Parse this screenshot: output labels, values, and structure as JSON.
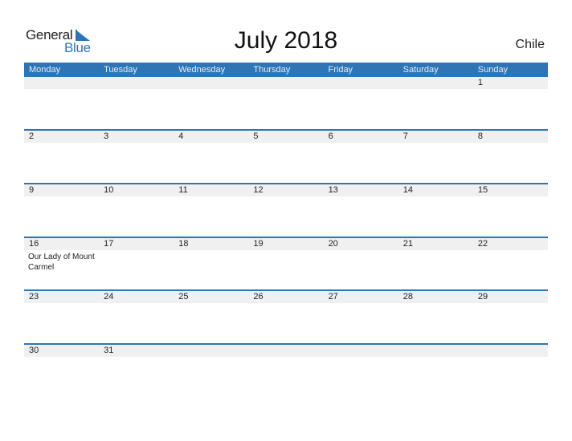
{
  "logo": {
    "line1": "General",
    "line2": "Blue",
    "icon": "triangle-flag-icon"
  },
  "title": "July 2018",
  "country": "Chile",
  "colors": {
    "accent": "#2e75b6",
    "strip": "#f0f0f0"
  },
  "weekdays": [
    "Monday",
    "Tuesday",
    "Wednesday",
    "Thursday",
    "Friday",
    "Saturday",
    "Sunday"
  ],
  "weeks": [
    {
      "days": [
        "",
        "",
        "",
        "",
        "",
        "",
        "1"
      ],
      "events": [
        "",
        "",
        "",
        "",
        "",
        "",
        ""
      ]
    },
    {
      "days": [
        "2",
        "3",
        "4",
        "5",
        "6",
        "7",
        "8"
      ],
      "events": [
        "",
        "",
        "",
        "",
        "",
        "",
        ""
      ]
    },
    {
      "days": [
        "9",
        "10",
        "11",
        "12",
        "13",
        "14",
        "15"
      ],
      "events": [
        "",
        "",
        "",
        "",
        "",
        "",
        ""
      ]
    },
    {
      "days": [
        "16",
        "17",
        "18",
        "19",
        "20",
        "21",
        "22"
      ],
      "events": [
        "Our Lady of Mount Carmel",
        "",
        "",
        "",
        "",
        "",
        ""
      ]
    },
    {
      "days": [
        "23",
        "24",
        "25",
        "26",
        "27",
        "28",
        "29"
      ],
      "events": [
        "",
        "",
        "",
        "",
        "",
        "",
        ""
      ]
    },
    {
      "days": [
        "30",
        "31",
        "",
        "",
        "",
        "",
        ""
      ],
      "events": [
        "",
        "",
        "",
        "",
        "",
        "",
        ""
      ]
    }
  ]
}
